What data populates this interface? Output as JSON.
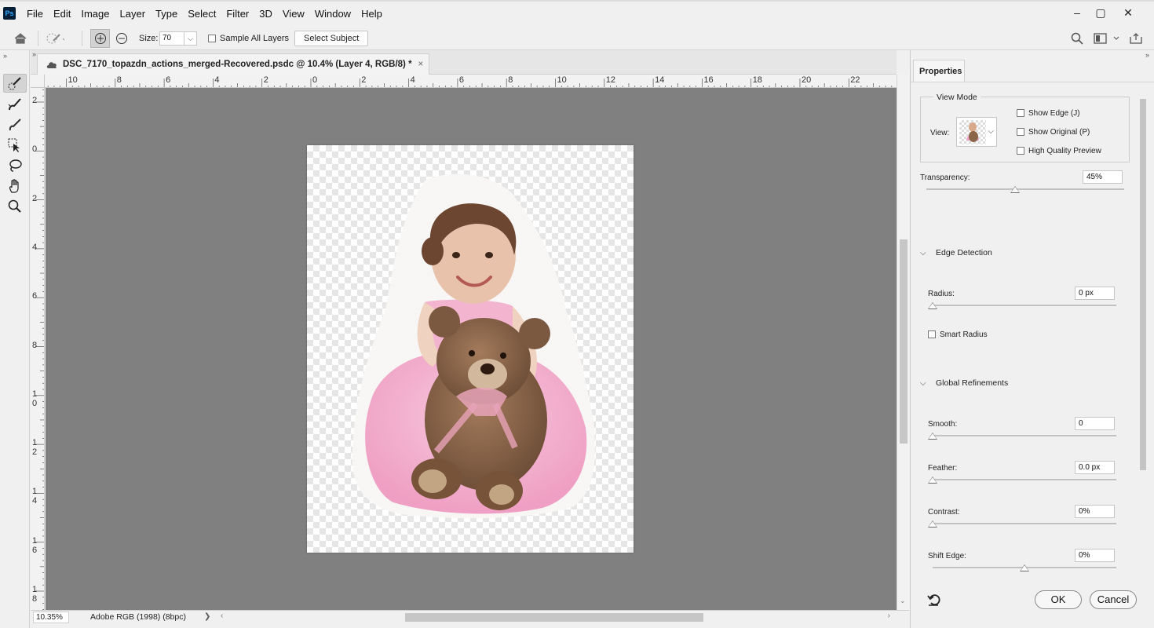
{
  "app": {
    "logo_text": "Ps",
    "menu": [
      "File",
      "Edit",
      "Image",
      "Layer",
      "Type",
      "Select",
      "Filter",
      "3D",
      "View",
      "Window",
      "Help"
    ],
    "window_buttons": {
      "minimize": "–",
      "maximize": "▢",
      "close": "✕"
    }
  },
  "options": {
    "size_label": "Size:",
    "size_value": "70",
    "sample_all_layers": "Sample All Layers",
    "select_subject": "Select Subject"
  },
  "document": {
    "tab_title": "DSC_7170_topazdn_actions_merged-Recovered.psdc @ 10.4% (Layer 4, RGB/8) *",
    "tab_close": "×",
    "ruler_top": [
      "10",
      "8",
      "6",
      "4",
      "2",
      "0",
      "2",
      "4",
      "6",
      "8",
      "10",
      "12",
      "14",
      "16",
      "18",
      "20",
      "22"
    ],
    "ruler_left": [
      "2",
      "0",
      "2",
      "4",
      "6",
      "8",
      "10",
      "12",
      "14",
      "16",
      "18"
    ],
    "zoom": "10.35%",
    "color_profile": "Adobe RGB (1998) (8bpc)",
    "status_arrow": "❯"
  },
  "properties": {
    "tab": "Properties",
    "view_mode": {
      "title": "View Mode",
      "view_label": "View:",
      "show_edge": "Show Edge (J)",
      "show_original": "Show Original (P)",
      "high_quality": "High Quality Preview"
    },
    "transparency": {
      "label": "Transparency:",
      "value": "45%",
      "fraction": 0.45
    },
    "edge_detection": {
      "title": "Edge Detection",
      "radius": {
        "label": "Radius:",
        "value": "0 px",
        "fraction": 0
      },
      "smart_radius": "Smart Radius"
    },
    "global_refinements": {
      "title": "Global Refinements",
      "smooth": {
        "label": "Smooth:",
        "value": "0",
        "fraction": 0
      },
      "feather": {
        "label": "Feather:",
        "value": "0.0 px",
        "fraction": 0
      },
      "contrast": {
        "label": "Contrast:",
        "value": "0%",
        "fraction": 0
      },
      "shift_edge": {
        "label": "Shift Edge:",
        "value": "0%",
        "fraction": 0.5
      }
    },
    "ok": "OK",
    "cancel": "Cancel"
  },
  "colors": {
    "canvas_bg": "#808080",
    "panel_bg": "#f0f0f0",
    "dress_pink": "#f4b8d4",
    "bear_brown": "#8a6548"
  }
}
